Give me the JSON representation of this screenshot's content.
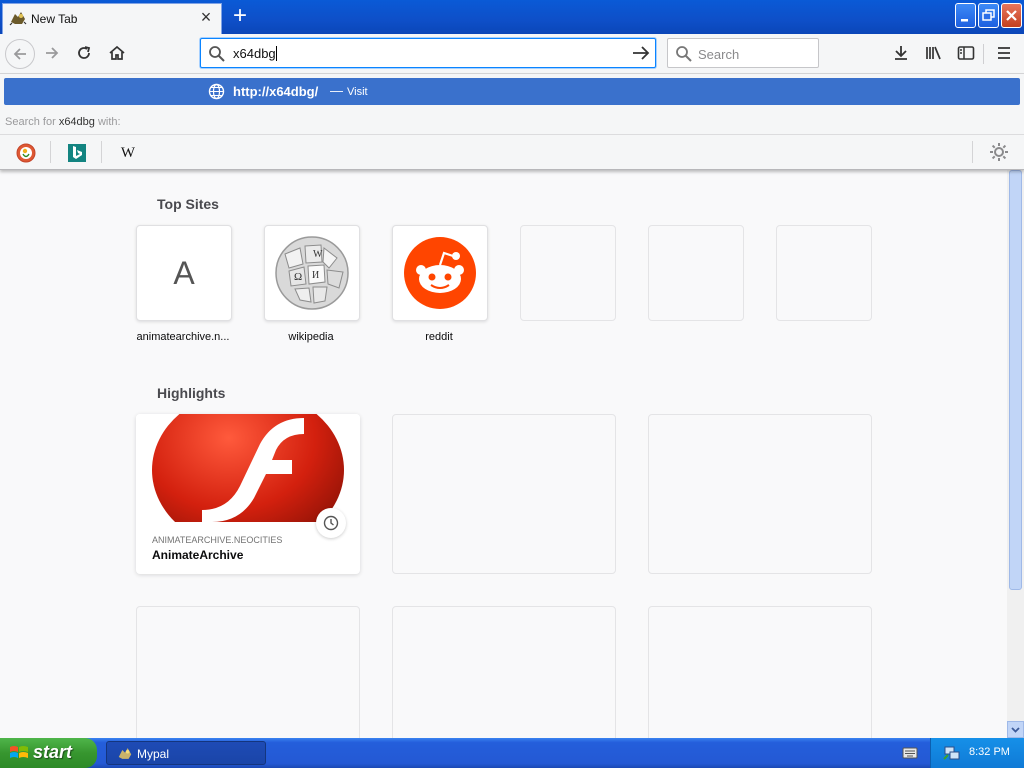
{
  "window": {
    "tab_title": "New Tab",
    "new_tab_symbol": "+"
  },
  "toolbar": {
    "url_value": "x64dbg",
    "search_placeholder": "Search"
  },
  "autocomplete": {
    "result_url": "http://x64dbg/",
    "result_separator": "—",
    "result_action": "Visit",
    "search_with_prefix": "Search for",
    "search_with_query": "x64dbg",
    "search_with_suffix": "with:",
    "engines": [
      "duckduckgo-icon",
      "bing-icon",
      "wikipedia-icon"
    ],
    "wikipedia_glyph": "W"
  },
  "newtab": {
    "top_sites_title": "Top Sites",
    "top_sites": [
      {
        "label": "animatearchive.n...",
        "letter": "A"
      },
      {
        "label": "wikipedia"
      },
      {
        "label": "reddit"
      }
    ],
    "highlights_title": "Highlights",
    "highlights": [
      {
        "domain": "ANIMATEARCHIVE.NEOCITIES",
        "title": "AnimateArchive"
      }
    ]
  },
  "taskbar": {
    "start_label": "start",
    "task_label": "Mypal",
    "clock": "8:32 PM"
  },
  "colors": {
    "accent": "#0a84ff",
    "result_highlight": "#3a71cc",
    "reddit": "#ff4500",
    "flash_red": "#d3200e"
  }
}
